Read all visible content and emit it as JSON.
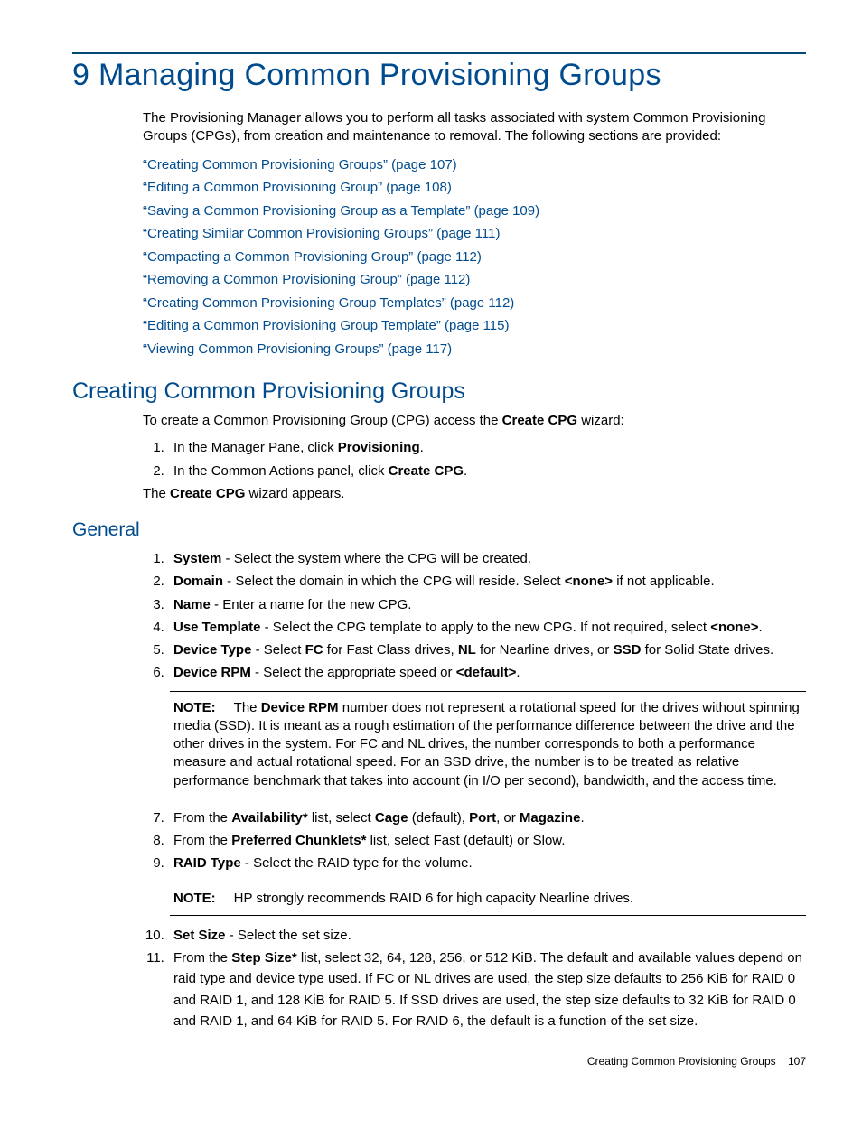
{
  "chapter": {
    "number": "9",
    "title": "Managing Common Provisioning Groups"
  },
  "intro": "The Provisioning Manager allows you to perform all tasks associated with system Common Provisioning Groups (CPGs), from creation and maintenance to removal. The following sections are provided:",
  "links": [
    "“Creating Common Provisioning Groups” (page 107)",
    "“Editing a Common Provisioning Group” (page 108)",
    "“Saving a Common Provisioning Group as a Template” (page 109)",
    "“Creating Similar Common Provisioning Groups” (page 111)",
    "“Compacting a Common Provisioning Group” (page 112)",
    "“Removing a Common Provisioning Group” (page 112)",
    "“Creating Common Provisioning Group Templates” (page 112)",
    "“Editing a Common Provisioning Group Template” (page 115)",
    "“Viewing Common Provisioning Groups” (page 117)"
  ],
  "section_creating": {
    "title": "Creating Common Provisioning Groups",
    "lead_pre": "To create a Common Provisioning Group (CPG) access the ",
    "lead_b": "Create CPG",
    "lead_post": " wizard:",
    "step1_pre": "In the Manager Pane, click ",
    "step1_b": "Provisioning",
    "step1_post": ".",
    "step2_pre": "In the Common Actions panel, click ",
    "step2_b": "Create CPG",
    "step2_post": ".",
    "after_pre": "The ",
    "after_b": "Create CPG",
    "after_post": " wizard appears."
  },
  "section_general": {
    "title": "General",
    "s1_b": "System",
    "s1_t": " - Select the system where the CPG will be created.",
    "s2_b": "Domain",
    "s2_t1": " - Select the domain in which the CPG will reside. Select ",
    "s2_b2": "<none>",
    "s2_t2": " if not applicable.",
    "s3_b": "Name",
    "s3_t": " - Enter a name for the new CPG.",
    "s4_b": "Use Template",
    "s4_t1": " - Select the CPG template to apply to the new CPG. If not required, select ",
    "s4_b2": "<none>",
    "s4_t2": ".",
    "s5_b": "Device Type",
    "s5_t1": " - Select ",
    "s5_b2": "FC",
    "s5_t2": " for Fast Class drives, ",
    "s5_b3": "NL",
    "s5_t3": " for Nearline drives, or ",
    "s5_b4": "SSD",
    "s5_t4": " for Solid State drives.",
    "s6_b": "Device RPM",
    "s6_t1": " - Select the appropriate speed or ",
    "s6_b2": "<default>",
    "s6_t2": ".",
    "note1_label": "NOTE:",
    "note1_t1": "The ",
    "note1_b1": "Device RPM",
    "note1_t2": " number does not represent a rotational speed for the drives without spinning media (SSD). It is meant as a rough estimation of the performance difference between the drive and the other drives in the system. For FC and NL drives, the number corresponds to both a performance measure and actual rotational speed. For an SSD drive, the number is to be treated as relative performance benchmark that takes into account (in I/O per second), bandwidth, and the access time.",
    "s7_t1": "From the ",
    "s7_b1": "Availability*",
    "s7_t2": " list, select ",
    "s7_b2": "Cage",
    "s7_t3": " (default), ",
    "s7_b3": "Port",
    "s7_t4": ", or ",
    "s7_b4": "Magazine",
    "s7_t5": ".",
    "s8_t1": "From the ",
    "s8_b1": "Preferred Chunklets*",
    "s8_t2": " list, select Fast (default) or Slow.",
    "s9_b1": "RAID Type",
    "s9_t1": " - Select the RAID type for the volume.",
    "note2_label": "NOTE:",
    "note2_t": "HP strongly recommends RAID 6 for high capacity Nearline drives.",
    "s10_b1": "Set Size",
    "s10_t1": " - Select the set size.",
    "s11_t1": "From the ",
    "s11_b1": "Step Size*",
    "s11_t2": " list, select 32, 64, 128, 256, or 512 KiB. The default and available values depend on raid type and device type used. If FC or NL drives are used, the step size defaults to 256 KiB for RAID 0 and RAID 1, and 128 KiB for RAID 5. If SSD drives are used, the step size defaults to 32 KiB for RAID 0 and RAID 1, and 64 KiB for RAID 5. For RAID 6, the default is a function of the set size."
  },
  "footer": {
    "text": "Creating Common Provisioning Groups",
    "page": "107"
  }
}
